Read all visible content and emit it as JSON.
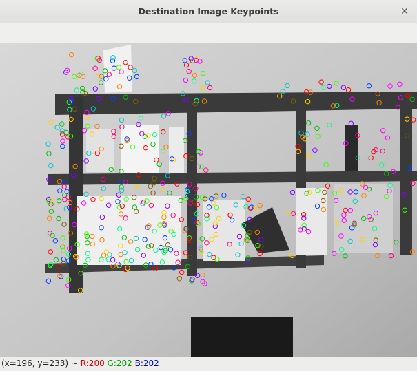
{
  "window": {
    "title": "Destination Image Keypoints",
    "close_icon": "close-icon"
  },
  "image": {
    "description_icon": "image-canvas",
    "keypoint_colors": [
      "#ff0000",
      "#00c000",
      "#0040ff",
      "#ffd000",
      "#ff00ff",
      "#00c8c8",
      "#ff8000",
      "#8000ff",
      "#00ff80",
      "#ff0080",
      "#806000",
      "#40ff00"
    ]
  },
  "status": {
    "coords": "(x=196, y=233) ~ ",
    "r": "R:200",
    "g": "G:202",
    "b": "B:202"
  }
}
